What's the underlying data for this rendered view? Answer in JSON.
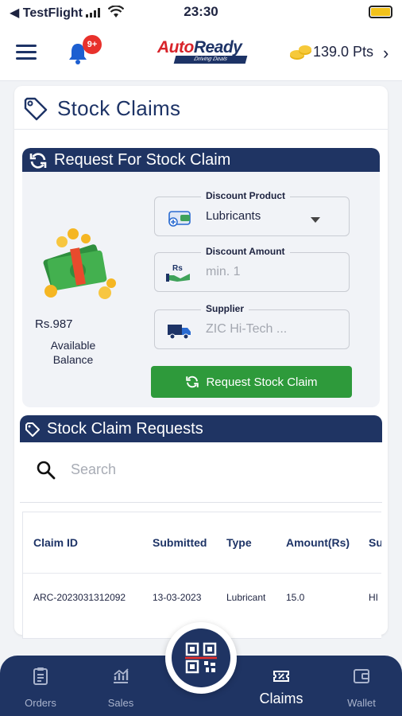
{
  "status_bar": {
    "carrier": "◀ TestFlight",
    "time": "23:30"
  },
  "header": {
    "notification_badge": "9+",
    "logo_main_a": "Auto",
    "logo_main_b": "Ready",
    "logo_tag": "Driving Deals",
    "points": "139.0 Pts"
  },
  "page": {
    "title": "Stock Claims"
  },
  "request_panel": {
    "title": "Request For Stock Claim",
    "balance_value": "Rs.987",
    "balance_label": "Available Balance",
    "discount_product": {
      "label": "Discount Product",
      "value": "Lubricants"
    },
    "discount_amount": {
      "label": "Discount Amount",
      "placeholder": "min. 1"
    },
    "supplier": {
      "label": "Supplier",
      "value": "ZIC Hi-Tech ..."
    },
    "submit_label": "Request Stock Claim"
  },
  "requests": {
    "title": "Stock Claim Requests",
    "search_placeholder": "Search",
    "columns": [
      "Claim ID",
      "Submitted",
      "Type",
      "Amount(Rs)",
      "Su"
    ],
    "rows": [
      {
        "claim_id": "ARC-2023031312092",
        "submitted": "13-03-2023",
        "type": "Lubricant",
        "amount": "15.0",
        "supplier": "HI"
      }
    ]
  },
  "bottom_nav": {
    "items": [
      {
        "label": "Orders",
        "icon": "clipboard-icon"
      },
      {
        "label": "Sales",
        "icon": "sales-chart-icon"
      },
      {
        "label": "Claims",
        "icon": "ticket-icon",
        "active": true
      },
      {
        "label": "Wallet",
        "icon": "wallet-icon"
      }
    ],
    "center": {
      "icon": "qr-scan-icon"
    }
  },
  "colors": {
    "navy": "#1f3463",
    "accent_red": "#d8232a",
    "green": "#2e9a3b"
  }
}
